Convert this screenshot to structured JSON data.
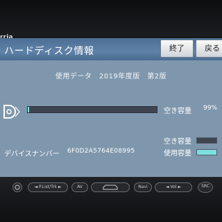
{
  "device": {
    "brand": "rria"
  },
  "window": {
    "title": "ハードディスク情報",
    "end_label": "終了",
    "back_label": "戻る"
  },
  "info": {
    "data_version": "使用データ　2019年度版　第2版",
    "free_space_label": "空き容量",
    "free_space_value": "99%",
    "used_fraction": 0.01,
    "device_number_label": "デバイスナンバー",
    "device_number_value": "6F0D2A5764E08995"
  },
  "legend": {
    "free_label": "空き容量",
    "used_label": "使用容量",
    "free_color": "#3e4450",
    "used_color": "#7de0e0"
  },
  "hardware_buttons": {
    "power_icon": "power-icon",
    "plist": "◄ P.List/Trk ►",
    "av": "AV",
    "car_icon": "car-icon",
    "navi": "Navi",
    "vol": "◄ Vol ►",
    "src": "SRC"
  }
}
